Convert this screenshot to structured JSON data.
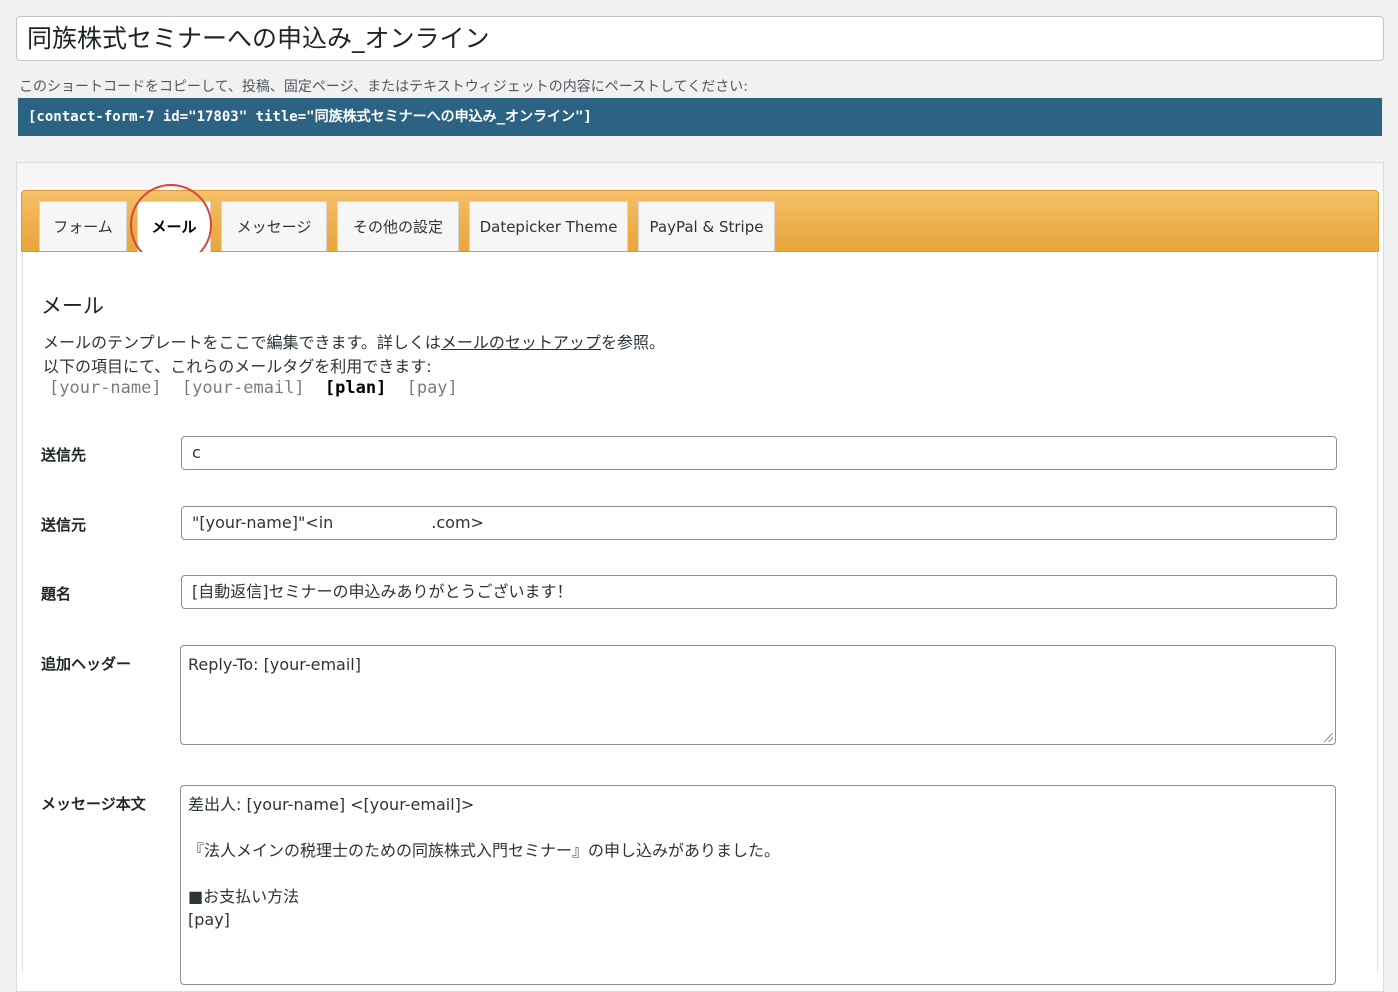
{
  "form_title": "同族株式セミナーへの申込み_オンライン",
  "shortcode_hint": "このショートコードをコピーして、投稿、固定ページ、またはテキストウィジェットの内容にペーストしてください:",
  "shortcode": "[contact-form-7 id=\"17803\" title=\"同族株式セミナーへの申込み_オンライン\"]",
  "tabs": [
    {
      "label": "フォーム",
      "active": false
    },
    {
      "label": "メール",
      "active": true
    },
    {
      "label": "メッセージ",
      "active": false
    },
    {
      "label": "その他の設定",
      "active": false
    },
    {
      "label": "Datepicker Theme",
      "active": false
    },
    {
      "label": "PayPal & Stripe",
      "active": false
    }
  ],
  "accent_colors": {
    "tabbar": "#eeb04c",
    "shortcode_bg": "#2c6383",
    "highlight_circle": "#d9453a"
  },
  "mail": {
    "section_title": "メール",
    "desc_prefix": "メールのテンプレートをここで編集できます。詳しくは",
    "desc_link": "メールのセットアップ",
    "desc_suffix": "を参照。",
    "desc_line2": "以下の項目にて、これらのメールタグを利用できます:",
    "tags": [
      {
        "text": "[your-name]",
        "used": false
      },
      {
        "text": "[your-email]",
        "used": false
      },
      {
        "text": "[plan]",
        "used": true
      },
      {
        "text": "[pay]",
        "used": false
      }
    ],
    "fields": {
      "to": {
        "label": "送信先",
        "value": "c"
      },
      "from": {
        "label": "送信元",
        "value_prefix": "\"[your-name]\"<in",
        "value_suffix": ".com>"
      },
      "subject": {
        "label": "題名",
        "value": "[自動返信]セミナーの申込みありがとうございます！"
      },
      "headers": {
        "label": "追加ヘッダー",
        "value": "Reply-To: [your-email]"
      },
      "body": {
        "label": "メッセージ本文",
        "value": "差出人: [your-name] <[your-email]>\n\n『法人メインの税理士のための同族株式入門セミナー』の申し込みがありました。\n\n■お支払い方法\n[pay]"
      }
    }
  }
}
